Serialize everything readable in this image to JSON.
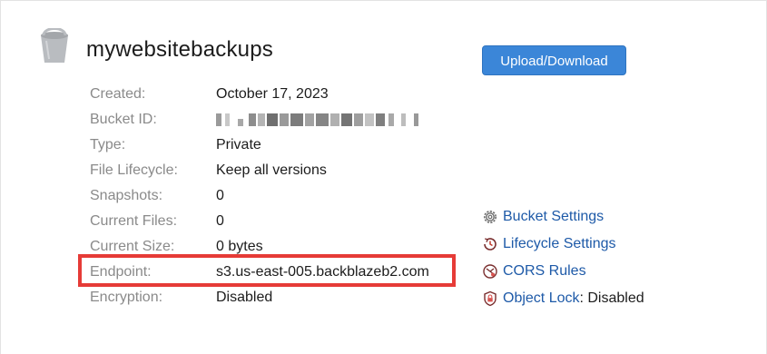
{
  "bucket": {
    "name": "mywebsitebackups",
    "upload_button": "Upload/Download"
  },
  "properties": [
    {
      "label": "Created:",
      "value": "October 17, 2023"
    },
    {
      "label": "Bucket ID:",
      "value": ""
    },
    {
      "label": "Type:",
      "value": "Private"
    },
    {
      "label": "File Lifecycle:",
      "value": "Keep all versions"
    },
    {
      "label": "Snapshots:",
      "value": "0"
    },
    {
      "label": "Current Files:",
      "value": "0"
    },
    {
      "label": "Current Size:",
      "value": "0 bytes"
    },
    {
      "label": "Endpoint:",
      "value": "s3.us-east-005.backblazeb2.com"
    },
    {
      "label": "Encryption:",
      "value": "Disabled"
    }
  ],
  "links": [
    {
      "label": "Bucket Settings",
      "icon": "gear-icon"
    },
    {
      "label": "Lifecycle Settings",
      "icon": "lifecycle-icon"
    },
    {
      "label": "CORS Rules",
      "icon": "cors-icon"
    },
    {
      "label": "Object Lock",
      "icon": "lock-shield-icon",
      "suffix": ": Disabled"
    }
  ],
  "colors": {
    "accent_button": "#3b86d8",
    "link": "#1e5aa8",
    "highlight": "#e63b37",
    "label": "#8a8a8a"
  }
}
